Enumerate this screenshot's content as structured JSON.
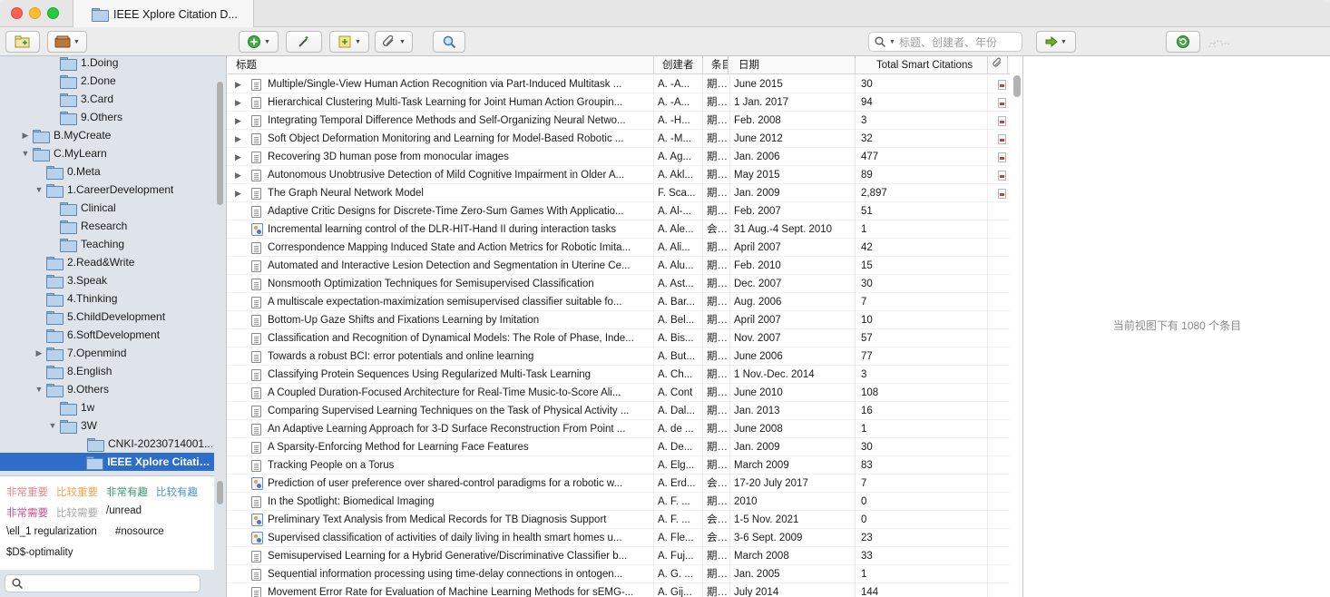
{
  "window": {
    "tab_title": "IEEE Xplore Citation D..."
  },
  "toolbar": {
    "search_placeholder": "标题、创建者、年份"
  },
  "colors": {
    "selection": "#2e6ec9",
    "sidebar_bg": "#dfe4ea"
  },
  "tree": [
    {
      "label": "1.Doing",
      "level": 3,
      "disclosure": ""
    },
    {
      "label": "2.Done",
      "level": 3,
      "disclosure": ""
    },
    {
      "label": "3.Card",
      "level": 3,
      "disclosure": ""
    },
    {
      "label": "9.Others",
      "level": 3,
      "disclosure": ""
    },
    {
      "label": "B.MyCreate",
      "level": 1,
      "disclosure": "▶"
    },
    {
      "label": "C.MyLearn",
      "level": 1,
      "disclosure": "▼"
    },
    {
      "label": "0.Meta",
      "level": 2,
      "disclosure": ""
    },
    {
      "label": "1.CareerDevelopment",
      "level": 2,
      "disclosure": "▼"
    },
    {
      "label": "Clinical",
      "level": 3,
      "disclosure": ""
    },
    {
      "label": "Research",
      "level": 3,
      "disclosure": ""
    },
    {
      "label": "Teaching",
      "level": 3,
      "disclosure": ""
    },
    {
      "label": "2.Read&Write",
      "level": 2,
      "disclosure": ""
    },
    {
      "label": "3.Speak",
      "level": 2,
      "disclosure": ""
    },
    {
      "label": "4.Thinking",
      "level": 2,
      "disclosure": ""
    },
    {
      "label": "5.ChildDevelopment",
      "level": 2,
      "disclosure": ""
    },
    {
      "label": "6.SoftDevelopment",
      "level": 2,
      "disclosure": ""
    },
    {
      "label": "7.Openmind",
      "level": 2,
      "disclosure": "▶"
    },
    {
      "label": "8.English",
      "level": 2,
      "disclosure": ""
    },
    {
      "label": "9.Others",
      "level": 2,
      "disclosure": "▼"
    },
    {
      "label": "1w",
      "level": 3,
      "disclosure": ""
    },
    {
      "label": "3W",
      "level": 3,
      "disclosure": "▼"
    },
    {
      "label": "CNKI-20230714001...",
      "level": 4,
      "disclosure": ""
    },
    {
      "label": "IEEE Xplore Citation...",
      "level": 4,
      "disclosure": "",
      "selected": true
    }
  ],
  "tags": {
    "very_important": "非常重要",
    "fairly_important": "比较重要",
    "very_interesting": "非常有趣",
    "fairly_interesting": "比较有趣",
    "very_needed": "非常需要",
    "fairly_needed": "比较需要",
    "unread": "/unread",
    "ell1": "\\ell_1 regularization",
    "nosource": "#nosource",
    "doptimality": "$D$-optimality"
  },
  "columns": {
    "title": "标题",
    "creator": "创建者",
    "type": "条目",
    "date": "日期",
    "citations": "Total Smart Citations"
  },
  "rows": [
    {
      "expand": true,
      "icon": "doc",
      "title": "Multiple/Single-View Human Action Recognition via Part-Induced Multitask ...",
      "creator": "A. -A...",
      "type": "期刊文章",
      "date": "June 2015",
      "citations": "30",
      "pdf": true
    },
    {
      "expand": true,
      "icon": "doc",
      "title": "Hierarchical Clustering Multi-Task Learning for Joint Human Action Groupin...",
      "creator": "A. -A...",
      "type": "期刊文章",
      "date": "1 Jan. 2017",
      "citations": "94",
      "pdf": true
    },
    {
      "expand": true,
      "icon": "doc",
      "title": "Integrating Temporal Difference Methods and Self-Organizing Neural Netwo...",
      "creator": "A. -H...",
      "type": "期刊文章",
      "date": "Feb. 2008",
      "citations": "3",
      "pdf": true
    },
    {
      "expand": true,
      "icon": "doc",
      "title": "Soft Object Deformation Monitoring and Learning for Model-Based Robotic ...",
      "creator": "A. -M...",
      "type": "期刊文章",
      "date": "June 2012",
      "citations": "32",
      "pdf": true
    },
    {
      "expand": true,
      "icon": "doc",
      "title": "Recovering 3D human pose from monocular images",
      "creator": "A. Ag...",
      "type": "期刊文章",
      "date": "Jan. 2006",
      "citations": "477",
      "pdf": true
    },
    {
      "expand": true,
      "icon": "doc",
      "title": "Autonomous Unobtrusive Detection of Mild Cognitive Impairment in Older A...",
      "creator": "A. Akl...",
      "type": "期刊文章",
      "date": "May 2015",
      "citations": "89",
      "pdf": true
    },
    {
      "expand": true,
      "icon": "doc",
      "title": "The Graph Neural Network Model",
      "creator": "F. Sca...",
      "type": "期刊文章",
      "date": "Jan. 2009",
      "citations": "2,897",
      "pdf": true
    },
    {
      "expand": false,
      "icon": "doc",
      "title": "Adaptive Critic Designs for Discrete-Time Zero-Sum Games With Applicatio...",
      "creator": "A. Al-...",
      "type": "期刊文章",
      "date": "Feb. 2007",
      "citations": "51",
      "pdf": false
    },
    {
      "expand": false,
      "icon": "conf",
      "title": "Incremental learning control of the DLR-HIT-Hand II during interaction tasks",
      "creator": "A. Ale...",
      "type": "会议论文",
      "date": "31 Aug.-4 Sept. 2010",
      "citations": "1",
      "pdf": false
    },
    {
      "expand": false,
      "icon": "doc",
      "title": "Correspondence Mapping Induced State and Action Metrics for Robotic Imita...",
      "creator": "A. Ali...",
      "type": "期刊文章",
      "date": "April 2007",
      "citations": "42",
      "pdf": false
    },
    {
      "expand": false,
      "icon": "doc",
      "title": "Automated and Interactive Lesion Detection and Segmentation in Uterine Ce...",
      "creator": "A. Alu...",
      "type": "期刊文章",
      "date": "Feb. 2010",
      "citations": "15",
      "pdf": false
    },
    {
      "expand": false,
      "icon": "doc",
      "title": "Nonsmooth Optimization Techniques for Semisupervised Classification",
      "creator": "A. Ast...",
      "type": "期刊文章",
      "date": "Dec. 2007",
      "citations": "30",
      "pdf": false
    },
    {
      "expand": false,
      "icon": "doc",
      "title": "A multiscale expectation-maximization semisupervised classifier suitable fo...",
      "creator": "A. Bar...",
      "type": "期刊文章",
      "date": "Aug. 2006",
      "citations": "7",
      "pdf": false
    },
    {
      "expand": false,
      "icon": "doc",
      "title": "Bottom-Up Gaze Shifts and Fixations Learning by Imitation",
      "creator": "A. Bel...",
      "type": "期刊文章",
      "date": "April 2007",
      "citations": "10",
      "pdf": false
    },
    {
      "expand": false,
      "icon": "doc",
      "title": "Classification and Recognition of Dynamical Models: The Role of Phase, Inde...",
      "creator": "A. Bis...",
      "type": "期刊文章",
      "date": "Nov. 2007",
      "citations": "57",
      "pdf": false
    },
    {
      "expand": false,
      "icon": "doc",
      "title": "Towards a robust BCI: error potentials and online learning",
      "creator": "A. But...",
      "type": "期刊文章",
      "date": "June 2006",
      "citations": "77",
      "pdf": false
    },
    {
      "expand": false,
      "icon": "doc",
      "title": "Classifying Protein Sequences Using Regularized Multi-Task Learning",
      "creator": "A. Ch...",
      "type": "期刊文章",
      "date": "1 Nov.-Dec. 2014",
      "citations": "3",
      "pdf": false
    },
    {
      "expand": false,
      "icon": "doc",
      "title": "A Coupled Duration-Focused Architecture for Real-Time Music-to-Score Ali...",
      "creator": "A. Cont",
      "type": "期刊文章",
      "date": "June 2010",
      "citations": "108",
      "pdf": false
    },
    {
      "expand": false,
      "icon": "doc",
      "title": "Comparing Supervised Learning Techniques on the Task of Physical Activity ...",
      "creator": "A. Dal...",
      "type": "期刊文章",
      "date": "Jan. 2013",
      "citations": "16",
      "pdf": false
    },
    {
      "expand": false,
      "icon": "doc",
      "title": "An Adaptive Learning Approach for 3-D Surface Reconstruction From Point ...",
      "creator": "A. de ...",
      "type": "期刊文章",
      "date": "June 2008",
      "citations": "1",
      "pdf": false
    },
    {
      "expand": false,
      "icon": "doc",
      "title": "A Sparsity-Enforcing Method for Learning Face Features",
      "creator": "A. De...",
      "type": "期刊文章",
      "date": "Jan. 2009",
      "citations": "30",
      "pdf": false
    },
    {
      "expand": false,
      "icon": "doc",
      "title": "Tracking People on a Torus",
      "creator": "A. Elg...",
      "type": "期刊文章",
      "date": "March 2009",
      "citations": "83",
      "pdf": false
    },
    {
      "expand": false,
      "icon": "conf",
      "title": "Prediction of user preference over shared-control paradigms for a robotic w...",
      "creator": "A. Erd...",
      "type": "会议论文",
      "date": "17-20 July 2017",
      "citations": "7",
      "pdf": false
    },
    {
      "expand": false,
      "icon": "doc",
      "title": "In the Spotlight: Biomedical Imaging",
      "creator": "A. F. ...",
      "type": "期刊文章",
      "date": "2010",
      "citations": "0",
      "pdf": false
    },
    {
      "expand": false,
      "icon": "conf",
      "title": "Preliminary Text Analysis from Medical Records for TB Diagnosis Support",
      "creator": "A. F. ...",
      "type": "会议论文",
      "date": "1-5 Nov. 2021",
      "citations": "0",
      "pdf": false
    },
    {
      "expand": false,
      "icon": "conf",
      "title": "Supervised classification of activities of daily living in health smart homes u...",
      "creator": "A. Fle...",
      "type": "会议论文",
      "date": "3-6 Sept. 2009",
      "citations": "23",
      "pdf": false
    },
    {
      "expand": false,
      "icon": "doc",
      "title": "Semisupervised Learning for a Hybrid Generative/Discriminative Classifier b...",
      "creator": "A. Fuj...",
      "type": "期刊文章",
      "date": "March 2008",
      "citations": "33",
      "pdf": false
    },
    {
      "expand": false,
      "icon": "doc",
      "title": "Sequential information processing using time-delay connections in ontogen...",
      "creator": "A. G. ...",
      "type": "期刊文章",
      "date": "Jan. 2005",
      "citations": "1",
      "pdf": false
    },
    {
      "expand": false,
      "icon": "doc",
      "title": "Movement Error Rate for Evaluation of Machine Learning Methods for sEMG-...",
      "creator": "A. Gij...",
      "type": "期刊文章",
      "date": "July 2014",
      "citations": "144",
      "pdf": false
    }
  ],
  "right": {
    "count_message": "当前视图下有 1080 个条目"
  }
}
